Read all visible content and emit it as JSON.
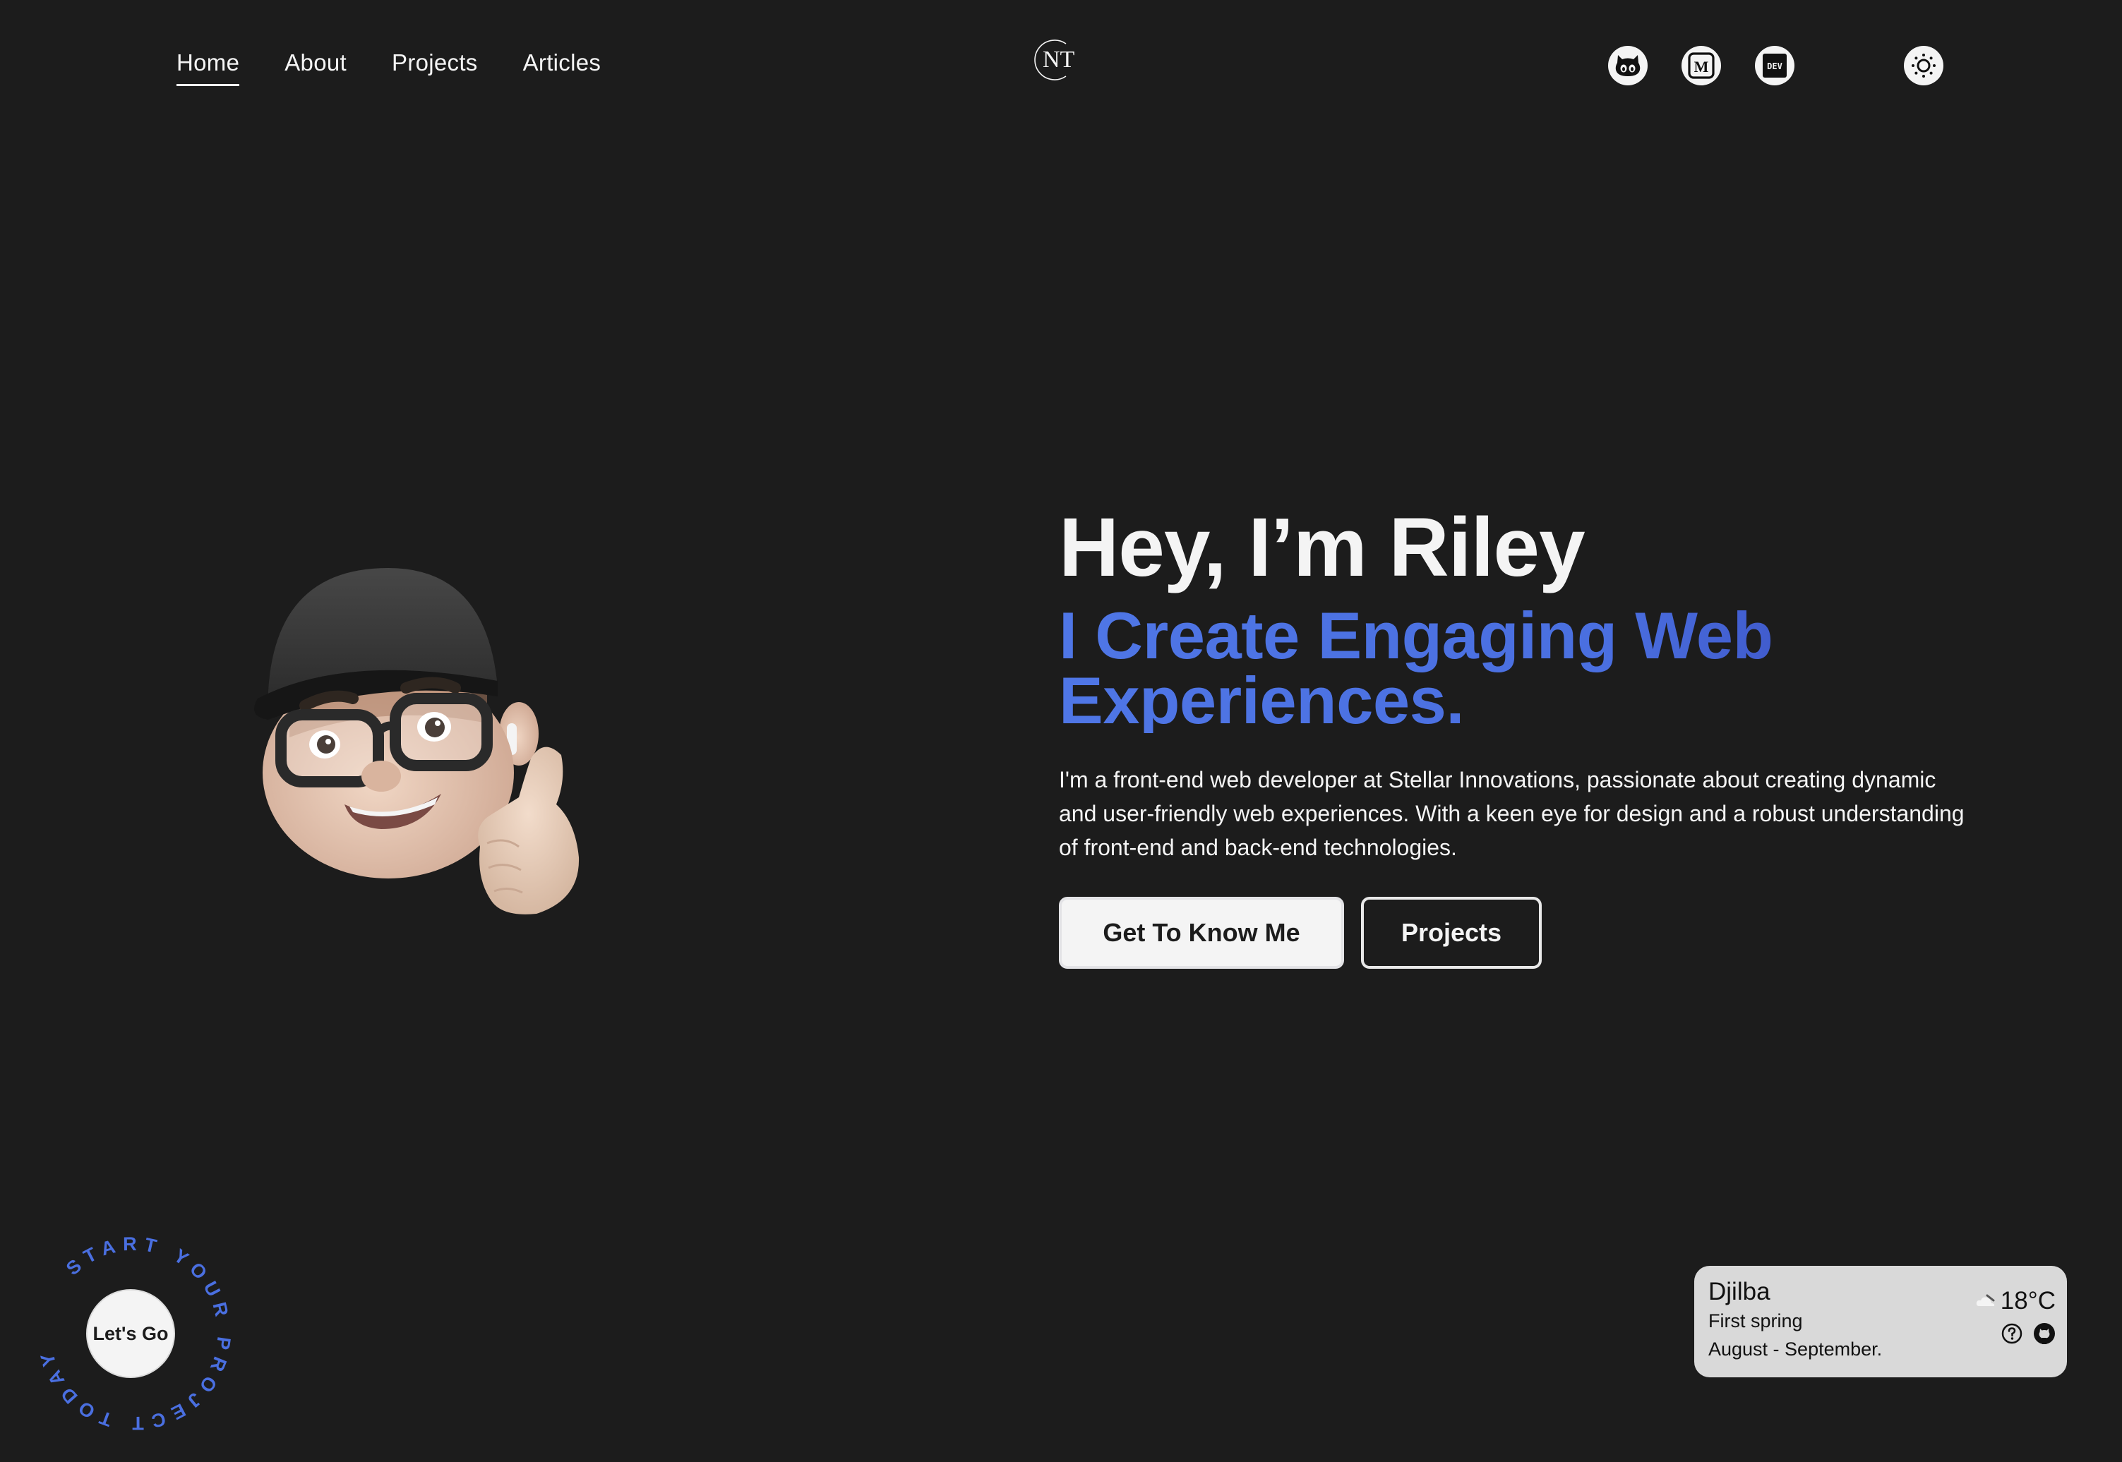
{
  "nav": {
    "items": [
      {
        "label": "Home",
        "active": true
      },
      {
        "label": "About",
        "active": false
      },
      {
        "label": "Projects",
        "active": false
      },
      {
        "label": "Articles",
        "active": false
      }
    ],
    "logo_text": "NT",
    "socials": [
      {
        "name": "GitHub",
        "icon": "github-icon"
      },
      {
        "name": "Medium",
        "icon": "medium-icon"
      },
      {
        "name": "DEV",
        "icon": "dev-icon",
        "text": "DEV"
      }
    ],
    "theme_toggle_icon": "sun-icon"
  },
  "hero": {
    "title": "Hey, I’m Riley",
    "subtitle": "I Create Engaging Web Experiences.",
    "description": "I'm a front-end web developer at Stellar Innovations, passionate about creating dynamic and user-friendly web experiences. With a keen eye for design and a robust understanding of front-end and back-end technologies.",
    "primary_button": "Get To Know Me",
    "secondary_button": "Projects"
  },
  "badge": {
    "circular_text": "START YOUR PROJECT TODAY ",
    "center_label": "Let's Go"
  },
  "weather": {
    "season": "Djilba",
    "season_desc": "First spring",
    "months": "August - September.",
    "temperature": "18°C",
    "condition_icon": "cloud-icon"
  },
  "colors": {
    "background": "#1c1c1c",
    "text": "#f4f4f4",
    "accent": "#4f76e6",
    "accent_dark": "#3646b8",
    "widget_bg": "#d9d9d9"
  }
}
